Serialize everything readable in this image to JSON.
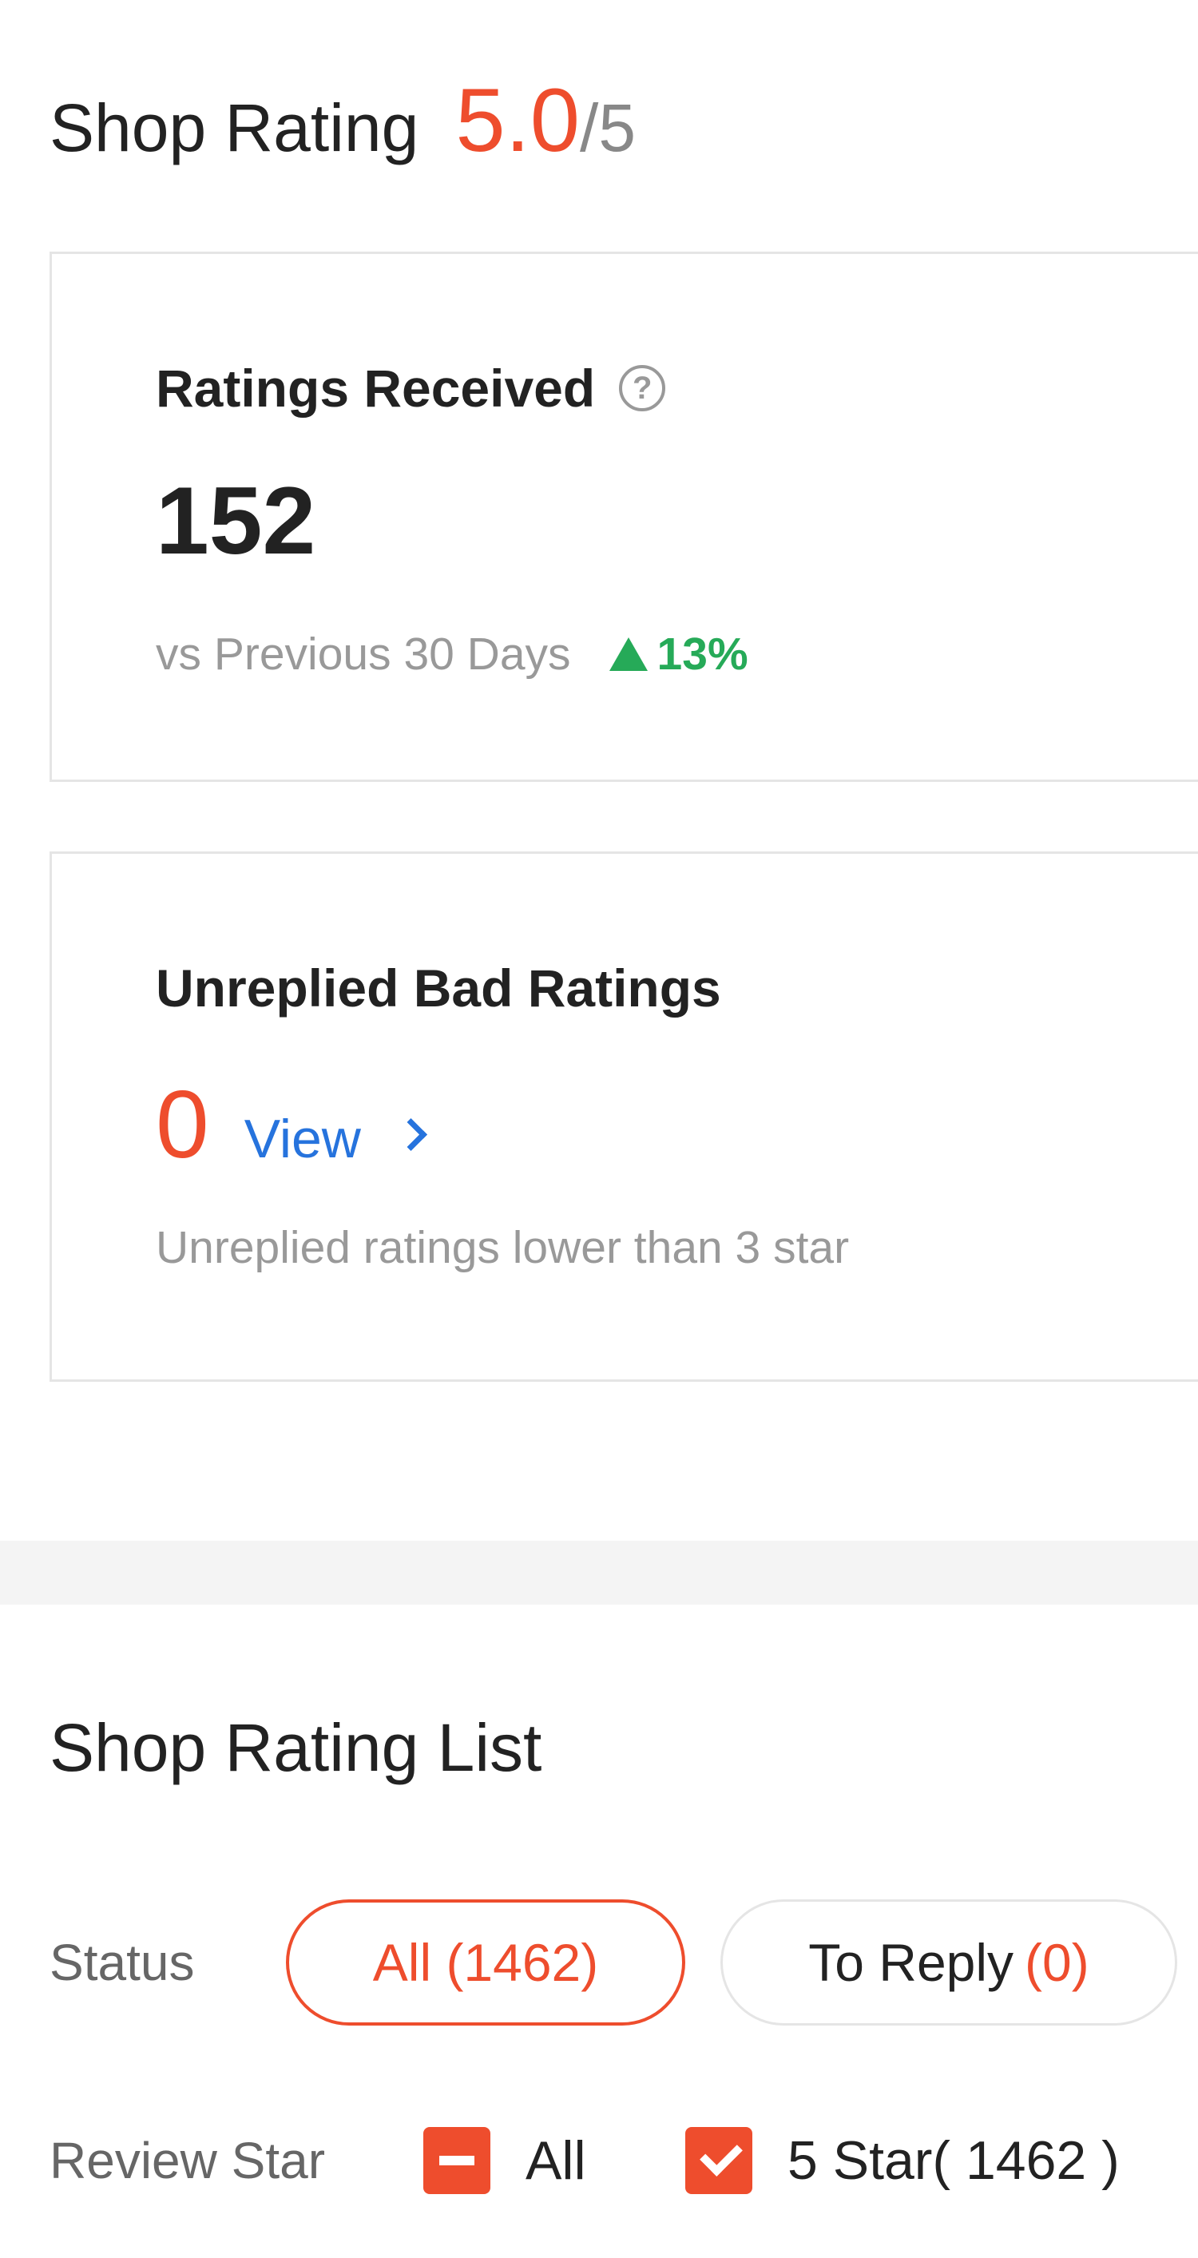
{
  "header": {
    "title": "Shop Rating",
    "score": "5.0",
    "max": "/5"
  },
  "ratings_received": {
    "title": "Ratings Received",
    "help_icon": "question-circle-icon",
    "value": "152",
    "compare_label": "vs Previous 30 Days",
    "trend_icon": "triangle-up-icon",
    "change": "13%",
    "trend_color": "#26aa58"
  },
  "unreplied_bad": {
    "title": "Unreplied Bad Ratings",
    "count": "0",
    "view_label": "View",
    "note": "Unreplied ratings lower than 3 star"
  },
  "list": {
    "title": "Shop Rating List",
    "status_label": "Status",
    "status_options": [
      {
        "label": "All (1462)",
        "active": true
      },
      {
        "label": "To Reply",
        "count": "(0)",
        "active": false
      }
    ],
    "review_star_label": "Review Star",
    "star_options": [
      {
        "label": "All",
        "state": "indeterminate"
      },
      {
        "label": "5 Star( 1462 )",
        "state": "checked"
      }
    ]
  },
  "colors": {
    "accent": "#ee4d2d",
    "link": "#2673dd",
    "positive": "#26aa58"
  }
}
